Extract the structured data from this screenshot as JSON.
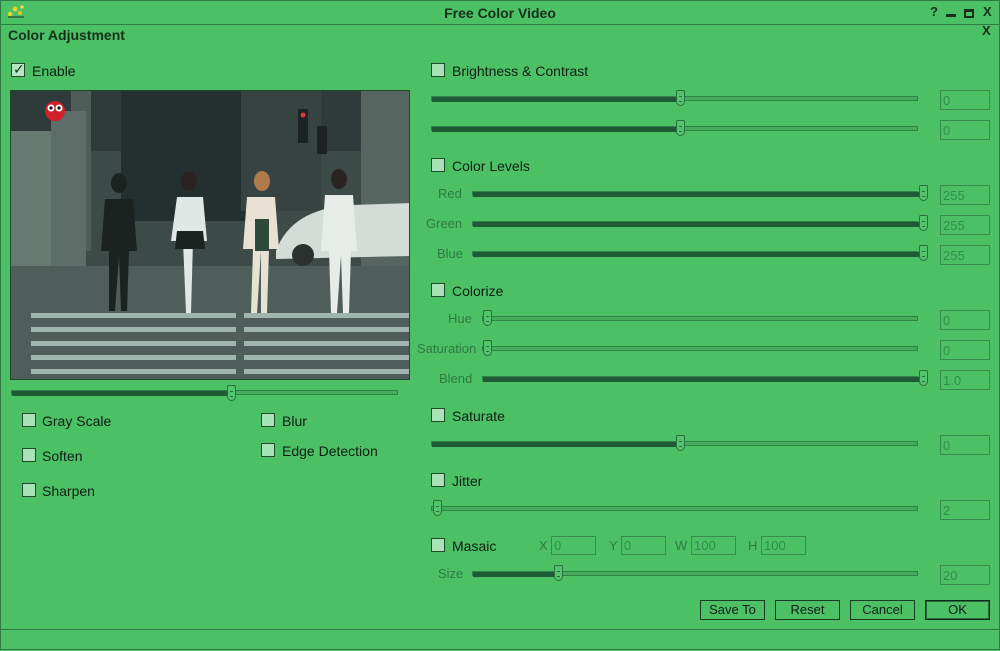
{
  "app": {
    "title": "Free Color Video",
    "help": "?",
    "minimize": "▄",
    "maximize": "▣",
    "close": "X"
  },
  "dialog": {
    "title": "Color Adjustment",
    "close": "X"
  },
  "enable": {
    "label": "Enable",
    "checked": true
  },
  "position_slider": {
    "value": 0.55
  },
  "effects": {
    "gray_scale": "Gray Scale",
    "blur": "Blur",
    "soften": "Soften",
    "edge_detection": "Edge Detection",
    "sharpen": "Sharpen"
  },
  "brightness_contrast": {
    "label": "Brightness & Contrast",
    "brightness_value": "0",
    "contrast_value": "0"
  },
  "color_levels": {
    "label": "Color Levels",
    "red_label": "Red",
    "red_value": "255",
    "green_label": "Green",
    "green_value": "255",
    "blue_label": "Blue",
    "blue_value": "255"
  },
  "colorize": {
    "label": "Colorize",
    "hue_label": "Hue",
    "hue_value": "0",
    "saturation_label": "Saturation",
    "saturation_value": "0",
    "blend_label": "Blend",
    "blend_value": "1.0"
  },
  "saturate": {
    "label": "Saturate",
    "value": "0"
  },
  "jitter": {
    "label": "Jitter",
    "value": "2"
  },
  "masaic": {
    "label": "Masaic",
    "x_label": "X",
    "x_value": "0",
    "y_label": "Y",
    "y_value": "0",
    "w_label": "W",
    "w_value": "100",
    "h_label": "H",
    "h_value": "100",
    "size_label": "Size",
    "size_value": "20"
  },
  "buttons": {
    "save_to": "Save To",
    "reset": "Reset",
    "cancel": "Cancel",
    "ok": "OK"
  },
  "colors": {
    "background": "#4cc065",
    "slider_fill": "#1e5a33",
    "field_text": "#2f8f4c"
  }
}
